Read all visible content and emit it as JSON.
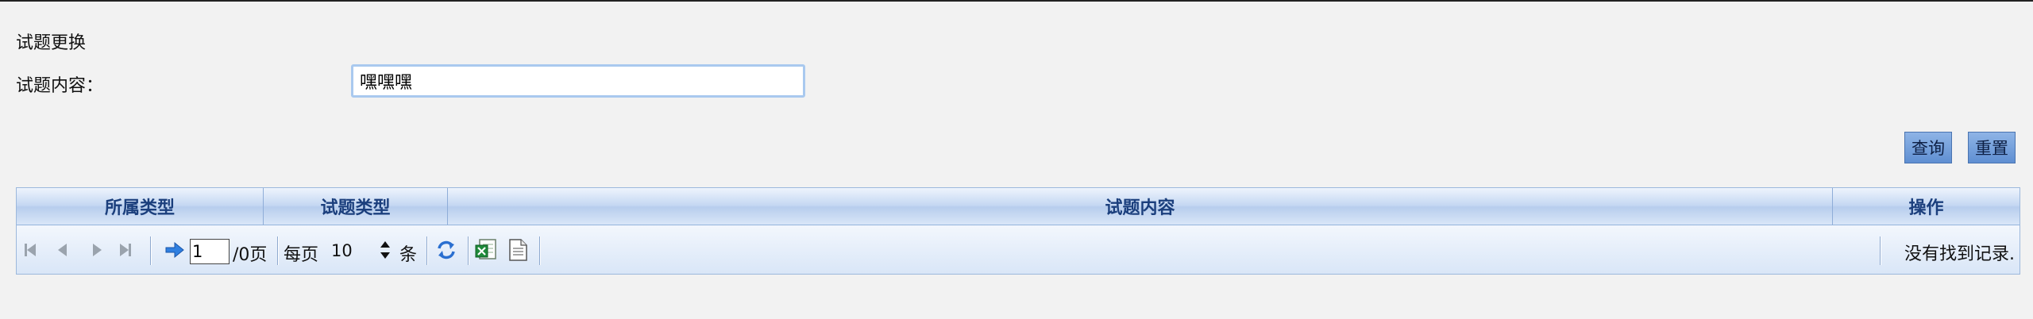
{
  "page": {
    "title": "试题更换"
  },
  "filter": {
    "content_label": "试题内容：",
    "content_value": "嘿嘿嘿",
    "query_label": "查询",
    "reset_label": "重置"
  },
  "grid": {
    "columns": [
      "所属类型",
      "试题类型",
      "试题内容",
      "操作"
    ],
    "rows": []
  },
  "pager": {
    "current_page": "1",
    "total_pages_text": "/0页",
    "per_page_label": "每页",
    "page_size": "10",
    "unit_label": "条",
    "status_text": "没有找到记录.",
    "icons": [
      "first-page-icon",
      "prev-page-icon",
      "next-page-icon",
      "last-page-icon",
      "go-arrow-icon",
      "refresh-icon",
      "excel-export-icon",
      "document-export-icon"
    ]
  }
}
